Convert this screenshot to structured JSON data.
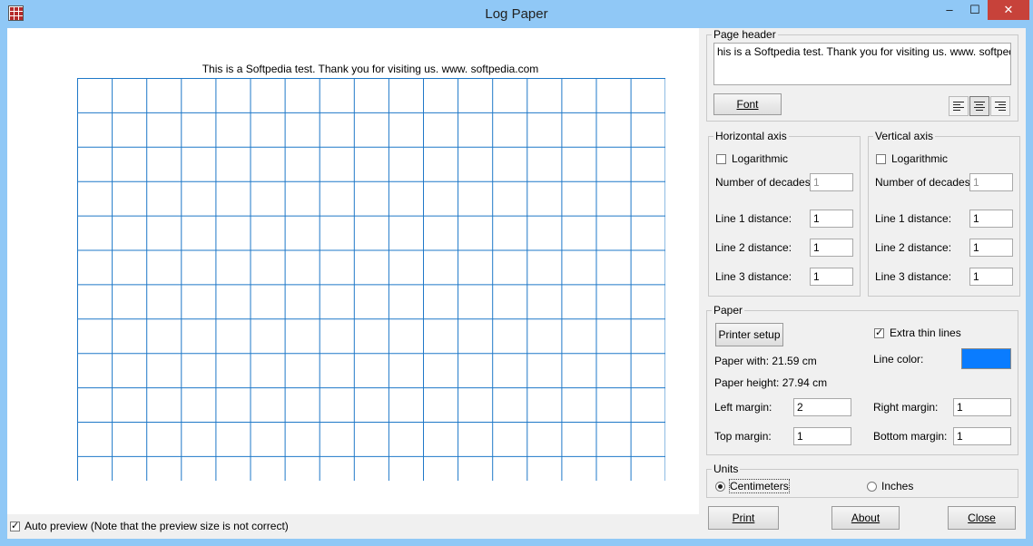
{
  "window": {
    "title": "Log Paper",
    "minimize": "–",
    "maximize": "☐",
    "close": "✕"
  },
  "preview": {
    "header_text": "This is a Softpedia test. Thank you for visiting us. www. softpedia.com",
    "grid_color": "#1f78c8",
    "grid_columns": 17,
    "grid_rows": 12
  },
  "auto_preview": {
    "label": "Auto preview (Note that the preview size is not correct)",
    "checked": true
  },
  "page_header": {
    "group_title": "Page header",
    "text_value": "his is a Softpedia test. Thank you for visiting us. www. softpedia.com",
    "font_button": "Font",
    "align_left_icon": "align-left-icon",
    "align_center_icon": "align-center-icon",
    "align_right_icon": "align-right-icon",
    "alignment": "center"
  },
  "horizontal_axis": {
    "group_title": "Horizontal axis",
    "logarithmic_label": "Logarithmic",
    "logarithmic_checked": false,
    "decades_label": "Number of decades:",
    "decades_value": "1",
    "line1_label": "Line 1 distance:",
    "line1_value": "1",
    "line2_label": "Line 2 distance:",
    "line2_value": "1",
    "line3_label": "Line 3 distance:",
    "line3_value": "1"
  },
  "vertical_axis": {
    "group_title": "Vertical axis",
    "logarithmic_label": "Logarithmic",
    "logarithmic_checked": false,
    "decades_label": "Number of decades:",
    "decades_value": "1",
    "line1_label": "Line 1 distance:",
    "line1_value": "1",
    "line2_label": "Line 2 distance:",
    "line2_value": "1",
    "line3_label": "Line 3 distance:",
    "line3_value": "1"
  },
  "paper": {
    "group_title": "Paper",
    "printer_setup_button": "Printer setup",
    "extra_thin_label": "Extra thin lines",
    "extra_thin_checked": true,
    "paper_width": "Paper with: 21.59 cm",
    "paper_height": "Paper height: 27.94 cm",
    "line_color_label": "Line color:",
    "line_color": "#0a7cff",
    "left_margin_label": "Left margin:",
    "left_margin_value": "2",
    "right_margin_label": "Right margin:",
    "right_margin_value": "1",
    "top_margin_label": "Top margin:",
    "top_margin_value": "1",
    "bottom_margin_label": "Bottom margin:",
    "bottom_margin_value": "1"
  },
  "units": {
    "group_title": "Units",
    "centimeters_label": "Centimeters",
    "inches_label": "Inches",
    "selected": "centimeters"
  },
  "footer": {
    "print_button": "Print",
    "about_button": "About",
    "close_button": "Close"
  }
}
